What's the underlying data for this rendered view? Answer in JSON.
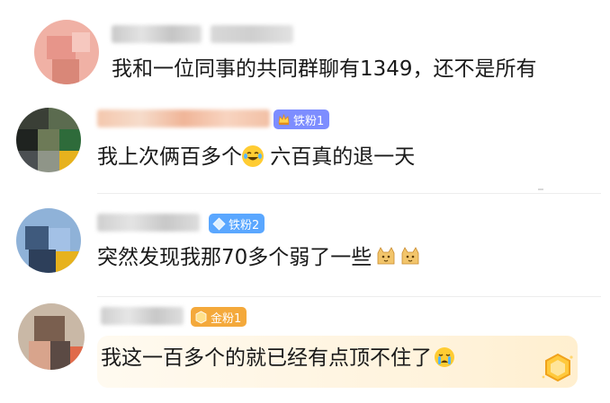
{
  "comments": [
    {
      "text": "我和一位同事的共同群聊有1349，还不是所有",
      "badge": null
    },
    {
      "text_before": "我上次俩百多个",
      "emoji_1": "laughing-tears-emoji",
      "text_after": " 六百真的退一天",
      "badge": {
        "label": "铁粉1",
        "color": "#7d8dff",
        "icon": "crown-icon"
      }
    },
    {
      "text": "突然发现我那70多个弱了一些",
      "emojis": [
        "cat-emoji",
        "cat-emoji"
      ],
      "badge": {
        "label": "铁粉2",
        "color": "#5aa7ff",
        "icon": "diamond-icon"
      }
    },
    {
      "text": "我这一百多个的就已经有点顶不住了",
      "emoji": "crying-emoji",
      "badge": {
        "label": "金粉1",
        "color": "#f4a93b",
        "icon": "gold-hexagon-icon"
      }
    }
  ],
  "colors": {
    "text": "#1a1a1a",
    "divider": "#ededed",
    "gold_bg": "#fff3dc"
  }
}
